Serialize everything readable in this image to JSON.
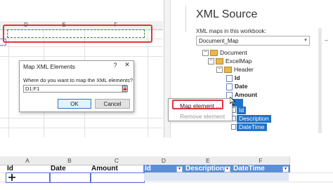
{
  "top_grid": {
    "columns": [
      "D",
      "E",
      "F"
    ]
  },
  "dialog": {
    "title": "Map XML Elements",
    "help": "?",
    "close": "✕",
    "prompt": "Where do you want to map the XML elements?",
    "range_value": "D1:F1",
    "ok_label": "OK",
    "cancel_label": "Cancel"
  },
  "xml_source": {
    "title": "XML Source",
    "maps_label": "XML maps in this workbook:",
    "selected_map": "Document_Map",
    "tree": {
      "document": "Document",
      "excelmap": "ExcelMap",
      "header": "Header",
      "id": "Id",
      "date": "Date",
      "amount": "Amount",
      "row_partial": "o",
      "row_id": "Id",
      "row_description": "Description",
      "row_datetime": "DateTime"
    },
    "context_menu": {
      "map_element": "Map element ...",
      "remove_element": "Remove element"
    }
  },
  "bottom_grid": {
    "columns": [
      "A",
      "B",
      "C",
      "D",
      "E",
      "F"
    ],
    "header_cells": [
      "Id",
      "Date",
      "Amount",
      "Id",
      "Description",
      "DateTime"
    ]
  }
}
